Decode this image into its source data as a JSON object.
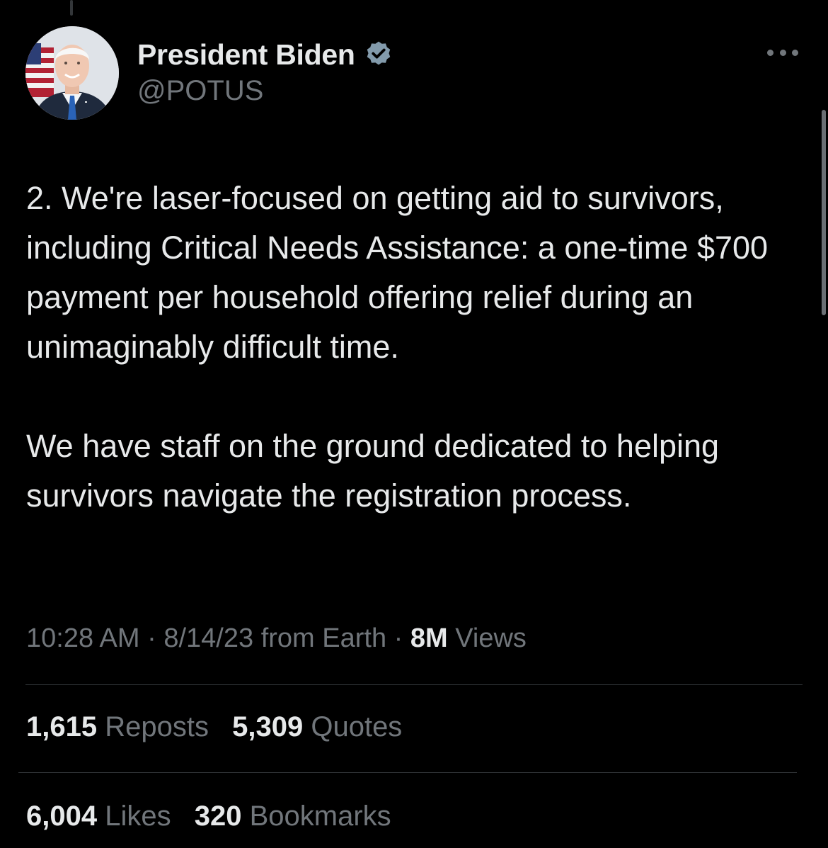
{
  "author": {
    "display_name": "President Biden",
    "handle": "@POTUS",
    "avatar_icon": "profile-photo-icon",
    "verified_icon": "verified-badge-icon",
    "verified_color": "#71767b"
  },
  "tweet": {
    "paragraph_1": "2. We're laser-focused on getting aid to survivors, including Critical Needs Assistance: a one-time $700 payment per household offering relief during an unimaginably difficult time.",
    "paragraph_2": "We have staff on the ground dedicated to helping survivors navigate the registration process."
  },
  "meta": {
    "time": "10:28 AM",
    "separator": "·",
    "date": "8/14/23",
    "source": "from Earth",
    "views_count": "8M",
    "views_label": "Views"
  },
  "stats": {
    "reposts_count": "1,615",
    "reposts_label": "Reposts",
    "quotes_count": "5,309",
    "quotes_label": "Quotes",
    "likes_count": "6,004",
    "likes_label": "Likes",
    "bookmarks_count": "320",
    "bookmarks_label": "Bookmarks"
  },
  "colors": {
    "background": "#000000",
    "primary_text": "#e7e9ea",
    "secondary_text": "#71767b",
    "divider": "#2f3336"
  }
}
